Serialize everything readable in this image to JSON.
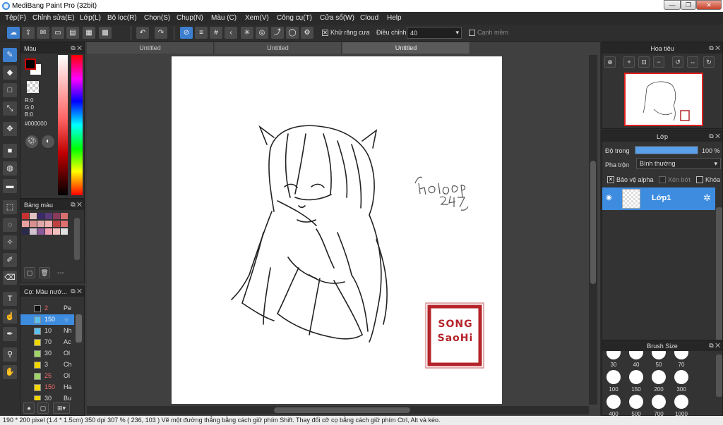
{
  "window": {
    "title": "MediBang Paint Pro (32bit)",
    "minimize": "—",
    "restore": "❐",
    "close": "✕"
  },
  "menu": [
    "Tệp(F)",
    "Chỉnh sửa(E)",
    "Lớp(L)",
    "Bộ lọc(R)",
    "Chọn(S)",
    "Chụp(N)",
    "Màu (C)",
    "Xem(V)",
    "Công cụ(T)",
    "Cửa sổ(W)",
    "Cloud",
    "Help"
  ],
  "toolbar": {
    "antialias_check": "✕",
    "antialias_label": "Khử răng cưa",
    "correction_label": "Điều chỉnh",
    "correction_value": "40",
    "smooth_label": "Cạnh mềm"
  },
  "color_panel": {
    "title": "Màu",
    "r": "R:0",
    "g": "G:0",
    "b": "B:0",
    "hex": "#000000",
    "primary": "#000000",
    "secondary": "#ffffff"
  },
  "palette_panel": {
    "title": "Bảng màu",
    "dots": "---",
    "swatches": [
      "#c83232",
      "#e0c0c0",
      "#3a2a6a",
      "#5a3a7a",
      "#8a3a5a",
      "#d87070",
      "#e8a0a0",
      "#d89090",
      "#e0a8a8",
      "#f0b0b0",
      "#c04040",
      "#e07070",
      "#2a2a4a",
      "#d0c0d0",
      "#8a5a9a",
      "#f0a0b0",
      "#f3c0c0",
      "#e0e0e0"
    ]
  },
  "brush_list": {
    "title": "Cọ: Màu nướ...",
    "items": [
      {
        "size": "2",
        "name": "Pe",
        "color": "#111111",
        "size_color": "#f06a6a"
      },
      {
        "size": "150",
        "name": "☼",
        "color": "#5bc0eb",
        "size_color": "#f06a6a",
        "active": true
      },
      {
        "size": "10",
        "name": "Nh",
        "color": "#5bc0eb",
        "size_color": "#dddddd"
      },
      {
        "size": "70",
        "name": "Ac",
        "color": "#f2d600",
        "size_color": "#dddddd"
      },
      {
        "size": "30",
        "name": "Ol",
        "color": "#a0d468",
        "size_color": "#dddddd"
      },
      {
        "size": "3",
        "name": "Ch",
        "color": "#f2d600",
        "size_color": "#dddddd"
      },
      {
        "size": "25",
        "name": "Ol",
        "color": "#a0d468",
        "size_color": "#f06a6a"
      },
      {
        "size": "150",
        "name": "Ha",
        "color": "#f2d600",
        "size_color": "#f06a6a"
      },
      {
        "size": "30",
        "name": "Bu",
        "color": "#f2d600",
        "size_color": "#dddddd"
      }
    ]
  },
  "tabs": [
    "Untitled",
    "Untitled",
    "Untitled"
  ],
  "canvas": {
    "stamp_line1": "SONG",
    "stamp_line2": "SaoHi",
    "note": "Hoi dap 247"
  },
  "navigator": {
    "title": "Hoa tiêu"
  },
  "layers": {
    "title": "Lớp",
    "opacity_label": "Độ trong",
    "opacity_value": "100 %",
    "opacity_fraction": 1.0,
    "blend_label": "Pha trộn",
    "blend_value": "Bình thường",
    "protect_alpha": "Bảo vệ alpha",
    "clipping": "Xén bớt",
    "lock": "Khóa",
    "layer_name": "Lớp1"
  },
  "brush_size": {
    "title": "Brush Size",
    "row1": [
      "30",
      "40",
      "50",
      "70"
    ],
    "row2": [
      "100",
      "150",
      "200",
      "300"
    ],
    "row3": [
      "400",
      "500",
      "700",
      "1000"
    ]
  },
  "status": "190 * 200 pixel   (1.4 * 1.5cm)   350 dpi   307 %   ( 236, 103 )   Vẽ một đường thẳng bằng cách giữ phím Shift. Thay đổi cỡ cọ bằng cách giữ phím Ctrl, Alt và kéo."
}
